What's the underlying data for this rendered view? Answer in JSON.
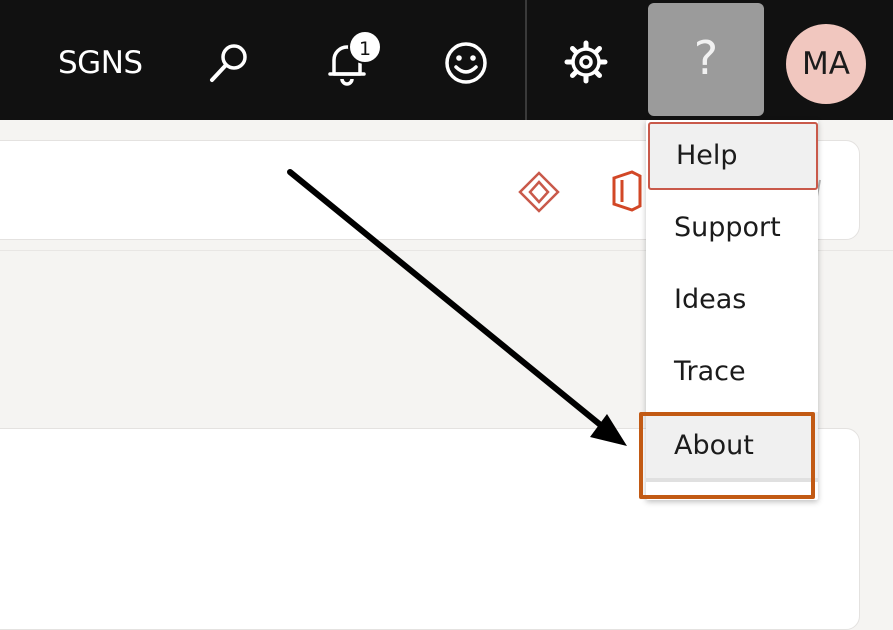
{
  "topbar": {
    "tenant_label": "SGNS",
    "notification_count": "1",
    "help_symbol": "?",
    "avatar_initials": "MA",
    "icons": [
      "search-icon",
      "bell-icon",
      "smile-icon",
      "gear-icon",
      "help-icon"
    ]
  },
  "help_menu": {
    "items": [
      {
        "label": "Help"
      },
      {
        "label": "Support"
      },
      {
        "label": "Ideas"
      },
      {
        "label": "Trace"
      },
      {
        "label": "About"
      }
    ]
  },
  "toolbar_icons": [
    "diamond-app-icon",
    "office-icon",
    "more-icon"
  ],
  "colors": {
    "topbar_bg": "#111111",
    "help_button_bg": "#9b9b9b",
    "avatar_bg": "#f1c7bf",
    "accent": "#c9594a",
    "annotation_box": "#c25a14",
    "annotation_arrow": "#000000"
  }
}
